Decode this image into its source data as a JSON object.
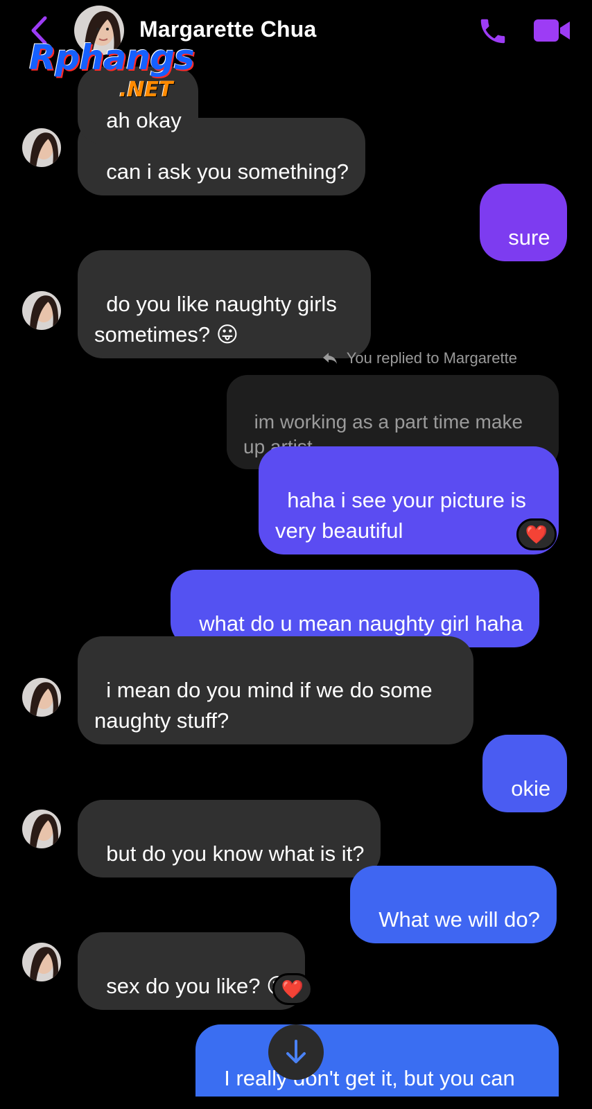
{
  "header": {
    "contact_name": "Margarette Chua",
    "back_icon": "chevron-left-icon",
    "call_icon": "phone-icon",
    "video_icon": "video-camera-icon",
    "accent_color": "#9d3cf5"
  },
  "watermark": {
    "main": "Rphangs",
    "sub": ".NET"
  },
  "messages": [
    {
      "id": "m0",
      "from": "contact",
      "text": "ah okay"
    },
    {
      "id": "m1",
      "from": "contact",
      "text": "can i ask you something?"
    },
    {
      "id": "m2",
      "from": "me",
      "text": "sure",
      "color": "#7d3cf0"
    },
    {
      "id": "m3",
      "from": "contact",
      "text": "do you like naughty girls\nsometimes? 😛"
    },
    {
      "id": "m4",
      "from": "me",
      "reply_label": "You replied to Margarette",
      "quoted": "im working as a part time make\nup artist",
      "text": "haha i see your picture is\nvery beautiful",
      "color": "#5b4cf2",
      "reaction": "❤️"
    },
    {
      "id": "m5",
      "from": "me",
      "text": "what do u mean naughty girl haha",
      "color": "#5452f2"
    },
    {
      "id": "m6",
      "from": "contact",
      "text": "i mean do you mind if we do some\nnaughty stuff?"
    },
    {
      "id": "m7",
      "from": "me",
      "text": "okie",
      "color": "#4a5cf2"
    },
    {
      "id": "m8",
      "from": "contact",
      "text": "but do you know what is it?"
    },
    {
      "id": "m9",
      "from": "me",
      "text": "What we will do?",
      "color": "#3f66f2"
    },
    {
      "id": "m10",
      "from": "contact",
      "text": "sex do you like? 😛",
      "reaction": "❤️"
    },
    {
      "id": "m11",
      "from": "me",
      "text": "I really don't get it, but you can\nshow it to me",
      "color": "#3a6ef2"
    }
  ],
  "scroll_button_icon": "arrow-down-icon"
}
